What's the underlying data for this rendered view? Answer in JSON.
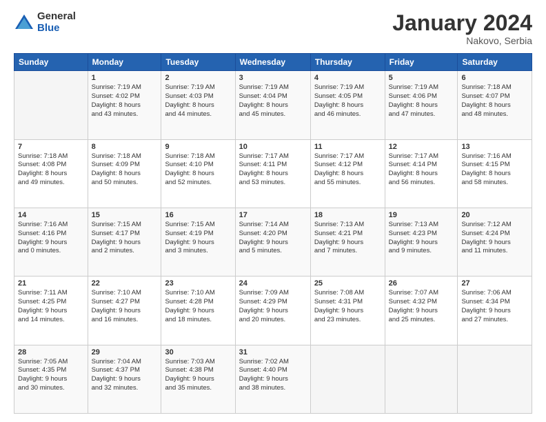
{
  "header": {
    "logo_general": "General",
    "logo_blue": "Blue",
    "month_title": "January 2024",
    "location": "Nakovo, Serbia"
  },
  "weekdays": [
    "Sunday",
    "Monday",
    "Tuesday",
    "Wednesday",
    "Thursday",
    "Friday",
    "Saturday"
  ],
  "weeks": [
    [
      {
        "num": "",
        "info": ""
      },
      {
        "num": "1",
        "info": "Sunrise: 7:19 AM\nSunset: 4:02 PM\nDaylight: 8 hours\nand 43 minutes."
      },
      {
        "num": "2",
        "info": "Sunrise: 7:19 AM\nSunset: 4:03 PM\nDaylight: 8 hours\nand 44 minutes."
      },
      {
        "num": "3",
        "info": "Sunrise: 7:19 AM\nSunset: 4:04 PM\nDaylight: 8 hours\nand 45 minutes."
      },
      {
        "num": "4",
        "info": "Sunrise: 7:19 AM\nSunset: 4:05 PM\nDaylight: 8 hours\nand 46 minutes."
      },
      {
        "num": "5",
        "info": "Sunrise: 7:19 AM\nSunset: 4:06 PM\nDaylight: 8 hours\nand 47 minutes."
      },
      {
        "num": "6",
        "info": "Sunrise: 7:18 AM\nSunset: 4:07 PM\nDaylight: 8 hours\nand 48 minutes."
      }
    ],
    [
      {
        "num": "7",
        "info": "Sunrise: 7:18 AM\nSunset: 4:08 PM\nDaylight: 8 hours\nand 49 minutes."
      },
      {
        "num": "8",
        "info": "Sunrise: 7:18 AM\nSunset: 4:09 PM\nDaylight: 8 hours\nand 50 minutes."
      },
      {
        "num": "9",
        "info": "Sunrise: 7:18 AM\nSunset: 4:10 PM\nDaylight: 8 hours\nand 52 minutes."
      },
      {
        "num": "10",
        "info": "Sunrise: 7:17 AM\nSunset: 4:11 PM\nDaylight: 8 hours\nand 53 minutes."
      },
      {
        "num": "11",
        "info": "Sunrise: 7:17 AM\nSunset: 4:12 PM\nDaylight: 8 hours\nand 55 minutes."
      },
      {
        "num": "12",
        "info": "Sunrise: 7:17 AM\nSunset: 4:14 PM\nDaylight: 8 hours\nand 56 minutes."
      },
      {
        "num": "13",
        "info": "Sunrise: 7:16 AM\nSunset: 4:15 PM\nDaylight: 8 hours\nand 58 minutes."
      }
    ],
    [
      {
        "num": "14",
        "info": "Sunrise: 7:16 AM\nSunset: 4:16 PM\nDaylight: 9 hours\nand 0 minutes."
      },
      {
        "num": "15",
        "info": "Sunrise: 7:15 AM\nSunset: 4:17 PM\nDaylight: 9 hours\nand 2 minutes."
      },
      {
        "num": "16",
        "info": "Sunrise: 7:15 AM\nSunset: 4:19 PM\nDaylight: 9 hours\nand 3 minutes."
      },
      {
        "num": "17",
        "info": "Sunrise: 7:14 AM\nSunset: 4:20 PM\nDaylight: 9 hours\nand 5 minutes."
      },
      {
        "num": "18",
        "info": "Sunrise: 7:13 AM\nSunset: 4:21 PM\nDaylight: 9 hours\nand 7 minutes."
      },
      {
        "num": "19",
        "info": "Sunrise: 7:13 AM\nSunset: 4:23 PM\nDaylight: 9 hours\nand 9 minutes."
      },
      {
        "num": "20",
        "info": "Sunrise: 7:12 AM\nSunset: 4:24 PM\nDaylight: 9 hours\nand 11 minutes."
      }
    ],
    [
      {
        "num": "21",
        "info": "Sunrise: 7:11 AM\nSunset: 4:25 PM\nDaylight: 9 hours\nand 14 minutes."
      },
      {
        "num": "22",
        "info": "Sunrise: 7:10 AM\nSunset: 4:27 PM\nDaylight: 9 hours\nand 16 minutes."
      },
      {
        "num": "23",
        "info": "Sunrise: 7:10 AM\nSunset: 4:28 PM\nDaylight: 9 hours\nand 18 minutes."
      },
      {
        "num": "24",
        "info": "Sunrise: 7:09 AM\nSunset: 4:29 PM\nDaylight: 9 hours\nand 20 minutes."
      },
      {
        "num": "25",
        "info": "Sunrise: 7:08 AM\nSunset: 4:31 PM\nDaylight: 9 hours\nand 23 minutes."
      },
      {
        "num": "26",
        "info": "Sunrise: 7:07 AM\nSunset: 4:32 PM\nDaylight: 9 hours\nand 25 minutes."
      },
      {
        "num": "27",
        "info": "Sunrise: 7:06 AM\nSunset: 4:34 PM\nDaylight: 9 hours\nand 27 minutes."
      }
    ],
    [
      {
        "num": "28",
        "info": "Sunrise: 7:05 AM\nSunset: 4:35 PM\nDaylight: 9 hours\nand 30 minutes."
      },
      {
        "num": "29",
        "info": "Sunrise: 7:04 AM\nSunset: 4:37 PM\nDaylight: 9 hours\nand 32 minutes."
      },
      {
        "num": "30",
        "info": "Sunrise: 7:03 AM\nSunset: 4:38 PM\nDaylight: 9 hours\nand 35 minutes."
      },
      {
        "num": "31",
        "info": "Sunrise: 7:02 AM\nSunset: 4:40 PM\nDaylight: 9 hours\nand 38 minutes."
      },
      {
        "num": "",
        "info": ""
      },
      {
        "num": "",
        "info": ""
      },
      {
        "num": "",
        "info": ""
      }
    ]
  ]
}
